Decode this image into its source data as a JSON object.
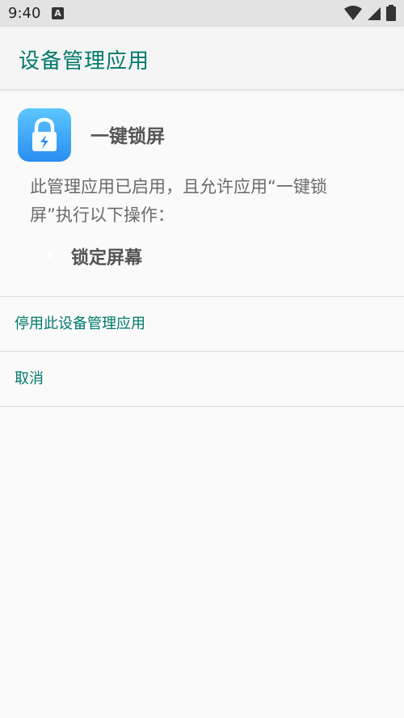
{
  "status_bar": {
    "time": "9:40",
    "notification_icon": "a-icon",
    "notification_glyph": "A",
    "icons": [
      "wifi-icon",
      "signal-icon",
      "battery-icon"
    ]
  },
  "app_bar": {
    "title": "设备管理应用"
  },
  "app": {
    "name": "一键锁屏",
    "icon": "lock-lightning-icon"
  },
  "description": "此管理应用已启用，且允许应用“一键锁屏”执行以下操作：",
  "policies": [
    "锁定屏幕"
  ],
  "actions": {
    "deactivate_label": "停用此设备管理应用",
    "cancel_label": "取消"
  },
  "colors": {
    "accent": "#00796b",
    "background": "#fafafa",
    "status_bar": "#e3e3e3"
  }
}
